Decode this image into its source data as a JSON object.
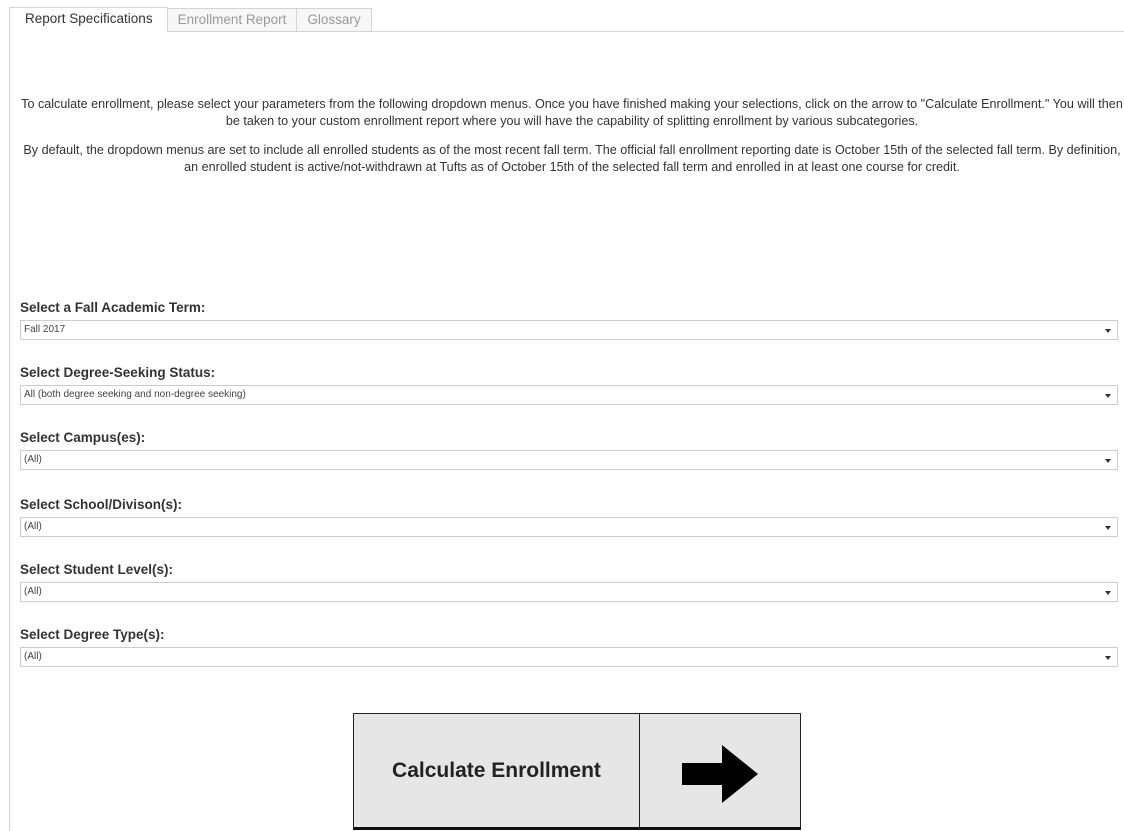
{
  "tabs": [
    {
      "label": "Report Specifications",
      "active": true
    },
    {
      "label": "Enrollment Report",
      "active": false
    },
    {
      "label": "Glossary",
      "active": false
    }
  ],
  "intro": {
    "paragraph1": "To calculate enrollment, please select your parameters from the following dropdown menus. Once you have finished making your selections, click on the arrow to \"Calculate Enrollment.\" You will then be taken to your custom enrollment report where you will have the capability of splitting enrollment by various subcategories.",
    "paragraph2": "By default, the dropdown menus are set to include all enrolled students as of the most recent fall term. The official fall enrollment reporting date is October 15th of the selected fall term. By definition, an enrolled student is active/not-withdrawn at Tufts as of October 15th of the selected fall term and enrolled in at least one course for credit."
  },
  "filters": [
    {
      "label": "Select a Fall Academic Term:",
      "value": "Fall 2017"
    },
    {
      "label": "Select Degree-Seeking Status:",
      "value": "All (both degree seeking and non-degree seeking)"
    },
    {
      "label": "Select Campus(es):",
      "value": "(All)"
    },
    {
      "label": "Select School/Divison(s):",
      "value": "(All)"
    },
    {
      "label": "Select Student Level(s):",
      "value": "(All)"
    },
    {
      "label": "Select Degree Type(s):",
      "value": "(All)"
    }
  ],
  "actions": {
    "calculate_label": "Calculate Enrollment",
    "arrow_icon": "right-arrow-icon"
  },
  "colors": {
    "button_bg": "#e6e6e6",
    "border": "#d4d4d4",
    "text": "#333333"
  }
}
